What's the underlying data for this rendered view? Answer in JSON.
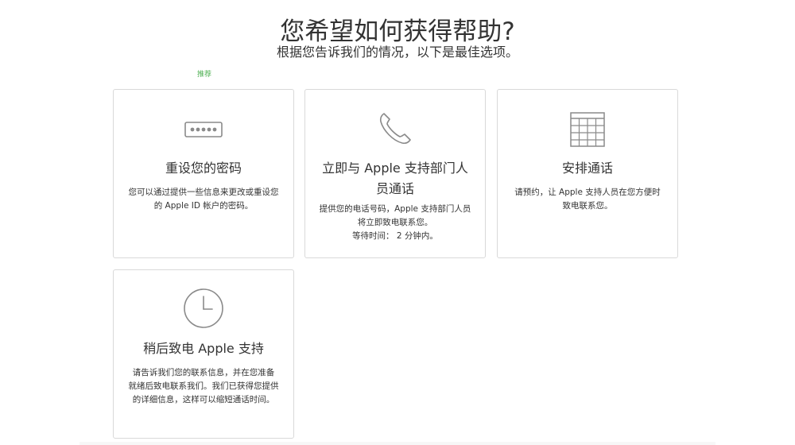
{
  "header": {
    "title": "您希望如何获得帮助?",
    "subtitle": "根据您告诉我们的情况，以下是最佳选项。"
  },
  "recommend_label": "推荐",
  "cards": [
    {
      "icon": "password-dots-icon",
      "title": "重设您的密码",
      "description_lines": [
        "您可以通过提供一些信息来更改或重设您",
        "的 Apple ID 帐户的密码。"
      ]
    },
    {
      "icon": "phone-icon",
      "title_lines": [
        "立即与 Apple 支持部门人",
        "员通话"
      ],
      "description_lines": [
        "提供您的电话号码，Apple 支持部门人员",
        "将立即致电联系您。"
      ],
      "wait_label": "等待时间：",
      "wait_value": "2 分钟内。"
    },
    {
      "icon": "calendar-grid-icon",
      "title": "安排通话",
      "description_lines": [
        "请预约，让 Apple 支持人员在您方便时",
        "致电联系您。"
      ]
    },
    {
      "icon": "clock-icon",
      "title": "稍后致电 Apple 支持",
      "description_lines": [
        "请告诉我们您的联系信息，并在您准备",
        "就绪后致电联系我们。我们已获得您提供",
        "的详细信息，这样可以缩短通话时间。"
      ]
    }
  ],
  "colors": {
    "recommend": "#4caf50",
    "card_border": "#d9d9d9",
    "icon_stroke": "#8a8a8a",
    "text": "#333333"
  }
}
